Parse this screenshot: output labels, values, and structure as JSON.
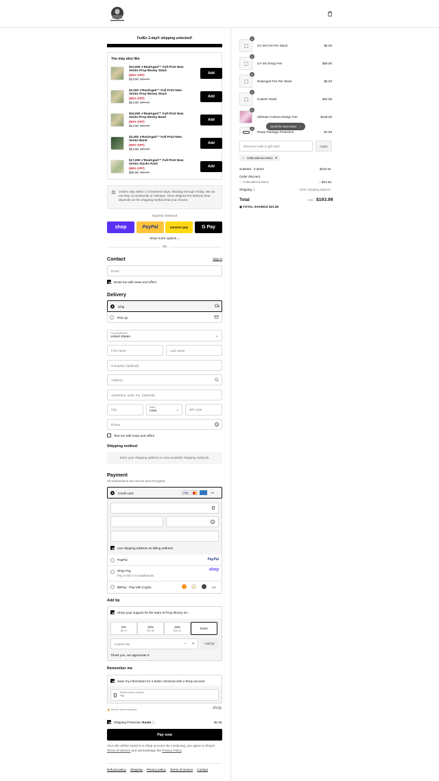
{
  "header": {
    "logo_text": "PROP MONEY"
  },
  "shipping_banner": {
    "text": "FedEx 2-day® shipping unlocked!"
  },
  "upsell": {
    "title": "You may also like",
    "add_label": "Add",
    "items": [
      {
        "name": "$10,000 ✔RealAged™ Full Print New Series Prop Money Stack",
        "discount": "(50% OFF)",
        "price": "$13.50",
        "compare": "$29.99"
      },
      {
        "name": "$2,000 ✔RealAged™ Full Print New Series Prop Money Stack",
        "discount": "(55% OFF)",
        "price": "$13.50",
        "compare": "$29.99"
      },
      {
        "name": "$10,000 ✔RealAged™ Full Print New Series Prop Money Band",
        "discount": "(50% OFF)",
        "price": "$13.50",
        "compare": "$29.99"
      },
      {
        "name": "$2,000 ✔RealAged™ Full Print New Series Band",
        "discount": "(55% OFF)",
        "price": "$13.50",
        "compare": "$29.99"
      },
      {
        "name": "$17,000 ✔RealAged™ Full Print New Series Stacks Pack",
        "discount": "(56% OFF)",
        "price": "$39.60",
        "compare": "$89.99"
      }
    ]
  },
  "notice": {
    "text": "Orders ship within 1-3 business days, Monday through Friday. We do not ship on weekends or holidays. Once shipped the delivery time depends on the shipping method that you choose."
  },
  "express": {
    "label": "Express checkout",
    "shop": "shop",
    "paypal": "PayPal",
    "amazon": "amazon pay",
    "gpay": "G Pay",
    "more": "Show more options",
    "or": "OR"
  },
  "contact": {
    "title": "Contact",
    "sign_in": "Sign in",
    "email_placeholder": "Email",
    "news_label": "Email me with news and offers"
  },
  "delivery": {
    "title": "Delivery",
    "ship": "Ship",
    "pickup": "Pick up",
    "country_label": "Country/Region",
    "country": "United States",
    "first_name": "First name",
    "last_name": "Last name",
    "company": "Company (optional)",
    "address": "Address",
    "apartment": "Apartment, suite, etc. (optional)",
    "city": "City",
    "state_label": "State",
    "state": "Iowa",
    "zip": "ZIP code",
    "phone": "Phone",
    "text_me": "Text me with news and offers"
  },
  "shipping_method": {
    "title": "Shipping method",
    "text": "Enter your shipping address to view available shipping methods."
  },
  "payment": {
    "title": "Payment",
    "subtitle": "All transactions are secure and encrypted.",
    "credit_card": "Credit card",
    "card_more": "+5",
    "billing_same": "Use shipping address as billing address",
    "paypal": "PayPal",
    "paypal_logo": "PayPal",
    "shop_pay": "Shop Pay",
    "shop_pay_sub": "Pay in full or in installments",
    "shop_logo": "shop",
    "bitpay": "BitPay - Pay with Crypto",
    "bitpay_more": "+11"
  },
  "tip": {
    "title": "Add tip",
    "support": "Show your support for the team at Prop Money Inc.",
    "options": [
      {
        "pct": "5%",
        "amt": "$6.70"
      },
      {
        "pct": "10%",
        "amt": "$13.40"
      },
      {
        "pct": "15%",
        "amt": "$20.10"
      }
    ],
    "none": "None",
    "custom": "Custom tip",
    "add": "Add tip",
    "thanks": "Thank you, we appreciate it."
  },
  "remember": {
    "title": "Remember me",
    "save": "Save my information for a faster checkout with a Shop account",
    "phone_label": "Mobile phone number",
    "phone_value": "+1",
    "secure": "Secure and encrypted",
    "shop": "shop"
  },
  "protection": {
    "label": "Shipping Protection",
    "brand": "Route",
    "price": "$1.55"
  },
  "pay_now": "Pay now",
  "legal": {
    "text": "Your info will be saved to a Shop account. By continuing, you agree to Shop's",
    "terms": "Terms of Service",
    "and": "and acknowledge the",
    "privacy": "Privacy Policy",
    "end": "."
  },
  "footer": {
    "links": [
      "Refund policy",
      "Shipping",
      "Privacy policy",
      "Terms of service",
      "Contact"
    ]
  },
  "summary": {
    "items": [
      {
        "name": "UV Ink Fee Per Stack",
        "price": "$5.00",
        "qty": "1"
      },
      {
        "name": "UV Ink Setup Fee",
        "price": "$50.00",
        "qty": "1"
      },
      {
        "name": "RealAged Fee Per Stack",
        "price": "$5.00",
        "qty": "1"
      },
      {
        "name": "Custom Stack",
        "price": "$24.99",
        "qty": "1"
      },
      {
        "name": "Ultimate Custom Design Fee",
        "price": "$129.00",
        "qty": "1"
      },
      {
        "name": "Route Package Protection",
        "price": "$1.55",
        "qty": "1"
      }
    ],
    "scroll_hint": "Scroll for more items",
    "discount_placeholder": "Discount code or gift card",
    "apply": "Apply",
    "code": "CHELSEAALANAA",
    "subtotal_label": "Subtotal · 6 items",
    "subtotal": "$215.54",
    "order_discount": "Order discount",
    "discount_code": "CHELSEAALANAA",
    "discount_value": "− $21.55",
    "shipping_label": "Shipping",
    "shipping_value": "Enter shipping address",
    "total_label": "Total",
    "currency": "USD",
    "total": "$193.99",
    "savings_label": "TOTAL SAVINGS",
    "savings": "$21.55"
  }
}
